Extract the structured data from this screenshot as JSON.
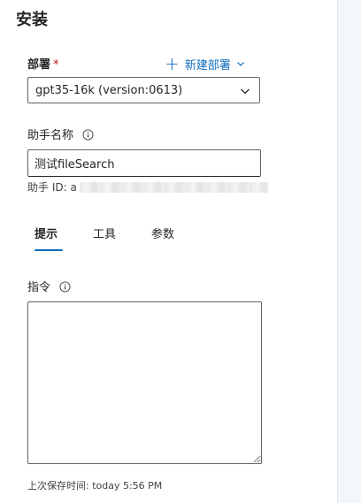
{
  "section": {
    "title": "安装"
  },
  "deployment": {
    "label": "部署",
    "required_mark": "*",
    "new_deployment_label": "新建部署",
    "selected_value": "gpt35-16k (version:0613)"
  },
  "assistant_name": {
    "label": "助手名称",
    "value": "测试fileSearch",
    "id_label": "助手 ID: a"
  },
  "tabs": [
    {
      "label": "提示",
      "active": true
    },
    {
      "label": "工具",
      "active": false
    },
    {
      "label": "参数",
      "active": false
    }
  ],
  "instructions": {
    "label": "指令",
    "value": ""
  },
  "status": {
    "last_saved": "上次保存时间: today 5:56 PM"
  },
  "colors": {
    "accent": "#0f6cbd",
    "required": "#c50f1f",
    "border": "#616161"
  },
  "icons": {
    "add": "plus-icon",
    "dropdown": "chevron-down-icon",
    "info": "info-icon"
  }
}
